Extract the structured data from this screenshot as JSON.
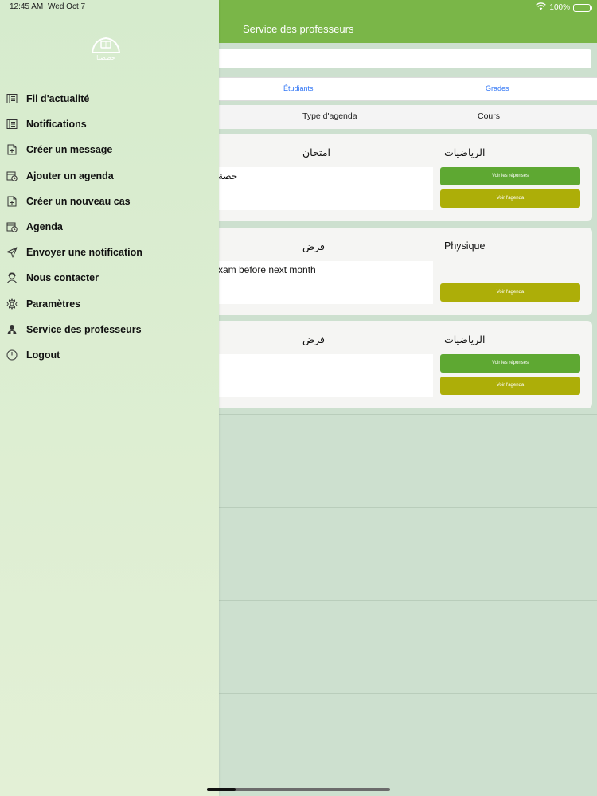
{
  "status": {
    "time": "12:45 AM",
    "date": "Wed Oct 7",
    "battery_text": "100%",
    "battery_level": 1.0
  },
  "header": {
    "title": "Service des professeurs"
  },
  "segments": {
    "students": "Étudiants",
    "grades": "Grades"
  },
  "filter": {
    "type_label": "Type d'agenda",
    "course_label": "Cours"
  },
  "cards": [
    {
      "type": "امتحان",
      "subject": "الرياضيات",
      "description": "حصة",
      "responses_button": "Voir les réponses",
      "agenda_button": "Voir l'agenda"
    },
    {
      "type": "فرض",
      "subject": "Physique",
      "description": "xam before next month",
      "agenda_button": "Voir l'agenda"
    },
    {
      "type": "فرض",
      "subject": "الرياضيات",
      "description": "",
      "responses_button": "Voir les réponses",
      "agenda_button": "Voir l'agenda"
    }
  ],
  "logo": {
    "text": "حصصنا"
  },
  "menu": [
    {
      "label": "Fil d'actualité",
      "icon": "news-feed-icon"
    },
    {
      "label": "Notifications",
      "icon": "notifications-icon"
    },
    {
      "label": "Créer un message",
      "icon": "create-message-icon"
    },
    {
      "label": "Ajouter un agenda",
      "icon": "add-agenda-icon"
    },
    {
      "label": "Créer un nouveau cas",
      "icon": "new-case-icon"
    },
    {
      "label": "Agenda",
      "icon": "agenda-icon"
    },
    {
      "label": "Envoyer une notification",
      "icon": "send-icon"
    },
    {
      "label": "Nous contacter",
      "icon": "contact-icon"
    },
    {
      "label": "Paramètres",
      "icon": "gear-icon"
    },
    {
      "label": "Service des professeurs",
      "icon": "teacher-icon"
    },
    {
      "label": "Logout",
      "icon": "power-icon"
    }
  ],
  "colors": {
    "header": "#7ab648",
    "responses_button": "#5ea832",
    "agenda_button": "#adae08",
    "tab_text": "#3478f6"
  }
}
